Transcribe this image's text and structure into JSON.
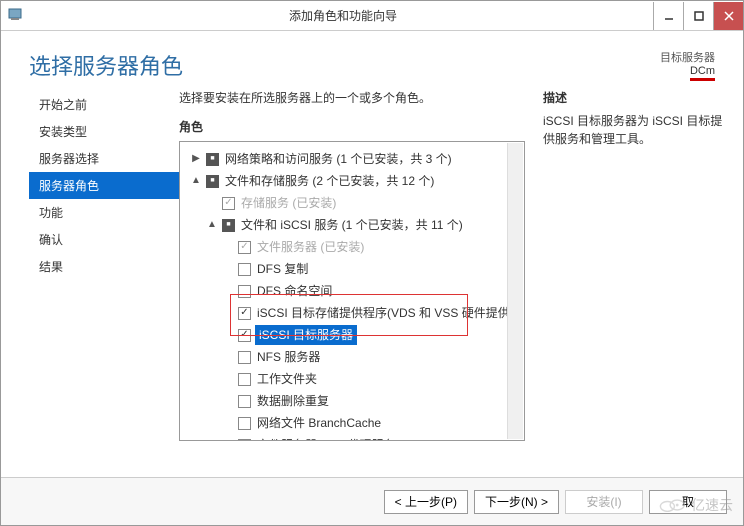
{
  "titlebar": {
    "text": "添加角色和功能向导"
  },
  "header": {
    "title": "选择服务器角色",
    "target_label": "目标服务器",
    "target_name": "DCm"
  },
  "nav": {
    "items": [
      {
        "label": "开始之前",
        "selected": false
      },
      {
        "label": "安装类型",
        "selected": false
      },
      {
        "label": "服务器选择",
        "selected": false
      },
      {
        "label": "服务器角色",
        "selected": true
      },
      {
        "label": "功能",
        "selected": false
      },
      {
        "label": "确认",
        "selected": false
      },
      {
        "label": "结果",
        "selected": false
      }
    ]
  },
  "main": {
    "instruction": "选择要安装在所选服务器上的一个或多个角色。",
    "roles_label": "角色",
    "desc_label": "描述",
    "desc_text": "iSCSI 目标服务器为 iSCSI 目标提供服务和管理工具。"
  },
  "tree": [
    {
      "indent": 1,
      "expander": "▶",
      "cb": "mixed",
      "label": "网络策略和访问服务 (1 个已安装，共 3 个)"
    },
    {
      "indent": 1,
      "expander": "▲",
      "cb": "mixed",
      "label": "文件和存储服务 (2 个已安装，共 12 个)"
    },
    {
      "indent": 2,
      "expander": "",
      "cb": "checked-grey",
      "label": "存储服务 (已安装)",
      "greyed": true
    },
    {
      "indent": 2,
      "expander": "▲",
      "cb": "mixed",
      "label": "文件和 iSCSI 服务 (1 个已安装，共 11 个)"
    },
    {
      "indent": 3,
      "expander": "",
      "cb": "checked-grey",
      "label": "文件服务器 (已安装)",
      "greyed": true
    },
    {
      "indent": 3,
      "expander": "",
      "cb": "unchecked",
      "label": "DFS 复制"
    },
    {
      "indent": 3,
      "expander": "",
      "cb": "unchecked",
      "label": "DFS 命名空间"
    },
    {
      "indent": 3,
      "expander": "",
      "cb": "checked",
      "label": "iSCSI 目标存储提供程序(VDS 和 VSS 硬件提供"
    },
    {
      "indent": 3,
      "expander": "",
      "cb": "checked",
      "label": "iSCSI 目标服务器",
      "selected": true
    },
    {
      "indent": 3,
      "expander": "",
      "cb": "unchecked",
      "label": "NFS 服务器"
    },
    {
      "indent": 3,
      "expander": "",
      "cb": "unchecked",
      "label": "工作文件夹"
    },
    {
      "indent": 3,
      "expander": "",
      "cb": "unchecked",
      "label": "数据删除重复"
    },
    {
      "indent": 3,
      "expander": "",
      "cb": "unchecked",
      "label": "网络文件 BranchCache"
    },
    {
      "indent": 3,
      "expander": "",
      "cb": "unchecked",
      "label": "文件服务器 VSS 代理服务"
    }
  ],
  "footer": {
    "prev": "< 上一步(P)",
    "next": "下一步(N) >",
    "install": "安装(I)",
    "cancel": "取"
  },
  "watermark": "亿速云"
}
